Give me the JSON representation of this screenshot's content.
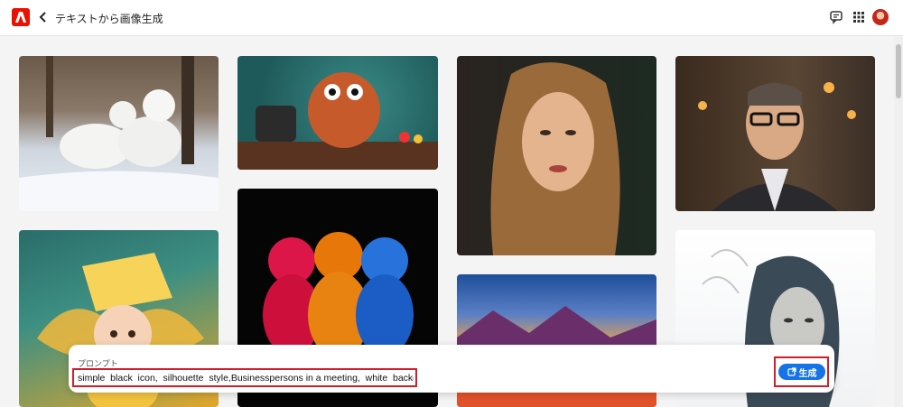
{
  "header": {
    "title": "テキストから画像生成",
    "logo_icon": "adobe-logo-icon",
    "back_icon": "chevron-left-icon",
    "feedback_icon": "chat-feedback-icon",
    "apps_icon": "apps-grid-icon",
    "avatar_icon": "user-avatar-icon"
  },
  "gallery": {
    "items": [
      {
        "subject": "arctic foxes in snowy forest",
        "icon": "image-thumbnail-icon"
      },
      {
        "subject": "button monster with sewing machine",
        "icon": "image-thumbnail-icon"
      },
      {
        "subject": "portrait of woman with long hair",
        "icon": "image-thumbnail-icon"
      },
      {
        "subject": "man with glasses in cafe",
        "icon": "image-thumbnail-icon"
      },
      {
        "subject": "cheese fairy doll",
        "icon": "image-thumbnail-icon"
      },
      {
        "subject": "glowing gummy bears",
        "icon": "image-thumbnail-icon"
      },
      {
        "subject": "colorful mountain landscape at sunset",
        "icon": "image-thumbnail-icon"
      },
      {
        "subject": "double exposure woman portrait",
        "icon": "image-thumbnail-icon"
      }
    ]
  },
  "prompt": {
    "label": "プロンプト",
    "value": "simple  black  icon,  silhouette  style,Businesspersons in a meeting,  white  background",
    "generate_label": "生成",
    "generate_icon": "generate-sparkle-icon"
  },
  "colors": {
    "brand": "#eb1000",
    "accent": "#1473e6",
    "highlight": "#d01f2a"
  }
}
